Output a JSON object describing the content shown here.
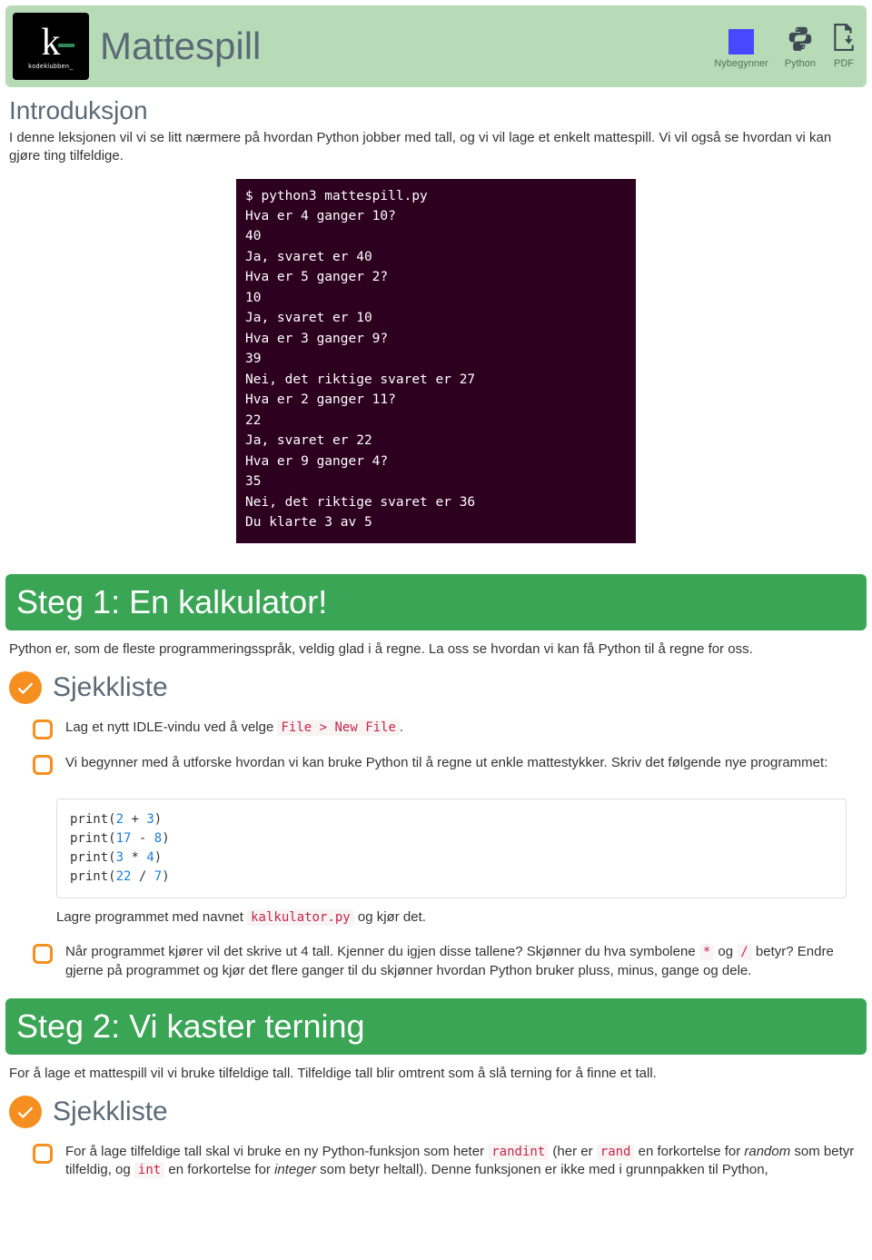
{
  "header": {
    "logo_label": "kodeklubben_",
    "title": "Mattespill",
    "level_label": "Nybegynner",
    "lang_label": "Python",
    "pdf_label": "PDF"
  },
  "intro": {
    "heading": "Introduksjon",
    "text": "I denne leksjonen vil vi se litt nærmere på hvordan Python jobber med tall, og vi vil lage et enkelt mattespill. Vi vil også se hvordan vi kan gjøre ting tilfeldige."
  },
  "terminal": {
    "lines": [
      "$ python3 mattespill.py",
      "Hva er 4 ganger 10?",
      "40",
      "Ja, svaret er 40",
      "Hva er 5 ganger 2?",
      "10",
      "Ja, svaret er 10",
      "Hva er 3 ganger 9?",
      "39",
      "Nei, det riktige svaret er 27",
      "Hva er 2 ganger 11?",
      "22",
      "Ja, svaret er 22",
      "Hva er 9 ganger 4?",
      "35",
      "Nei, det riktige svaret er 36",
      "Du klarte 3 av 5"
    ]
  },
  "step1": {
    "title": "Steg 1: En kalkulator!",
    "desc": "Python er, som de fleste programmeringsspråk, veldig glad i å regne. La oss se hvordan vi kan få Python til å regne for oss.",
    "checklist_label": "Sjekkliste",
    "item1_pre": "Lag et nytt IDLE-vindu ved å velge ",
    "item1_code": "File > New File",
    "item1_post": ".",
    "item2": "Vi begynner med å utforske hvordan vi kan bruke Python til å regne ut enkle mattestykker. Skriv det følgende nye programmet:",
    "code_lines": [
      {
        "fn": "print",
        "open": "(",
        "a": "2",
        "op": " + ",
        "b": "3",
        "close": ")"
      },
      {
        "fn": "print",
        "open": "(",
        "a": "17",
        "op": " - ",
        "b": "8",
        "close": ")"
      },
      {
        "fn": "print",
        "open": "(",
        "a": "3",
        "op": " * ",
        "b": "4",
        "close": ")"
      },
      {
        "fn": "print",
        "open": "(",
        "a": "22",
        "op": " / ",
        "b": "7",
        "close": ")"
      }
    ],
    "save_pre": "Lagre programmet med navnet ",
    "save_code": "kalkulator.py",
    "save_post": " og kjør det.",
    "item3_pre": "Når programmet kjører vil det skrive ut 4 tall. Kjenner du igjen disse tallene? Skjønner du hva symbolene ",
    "item3_star": "*",
    "item3_mid": " og ",
    "item3_slash": "/",
    "item3_post": " betyr? Endre gjerne på programmet og kjør det flere ganger til du skjønner hvordan Python bruker pluss, minus, gange og dele."
  },
  "step2": {
    "title": "Steg 2: Vi kaster terning",
    "desc": "For å lage et mattespill vil vi bruke tilfeldige tall. Tilfeldige tall blir omtrent som å slå terning for å finne et tall.",
    "checklist_label": "Sjekkliste",
    "item1_pre": "For å lage tilfeldige tall skal vi bruke en ny Python-funksjon som heter ",
    "item1_c1": "randint",
    "item1_mid1": " (her er ",
    "item1_c2": "rand",
    "item1_mid2": " en forkortelse for ",
    "item1_em1": "random",
    "item1_mid3": " som betyr tilfeldig, og ",
    "item1_c3": "int",
    "item1_mid4": " en forkortelse for ",
    "item1_em2": "integer",
    "item1_post": " som betyr heltall). Denne funksjonen er ikke med i grunnpakken til Python,"
  }
}
